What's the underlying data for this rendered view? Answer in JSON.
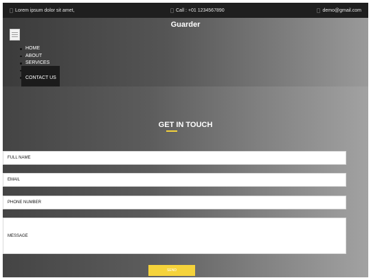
{
  "topbar": {
    "left_text": "Lorem ipsum dolor sit amet,",
    "center_text": "Call : +01 1234567890",
    "right_text": "demo@gmail.com"
  },
  "header": {
    "brand": "Guarder"
  },
  "nav": {
    "items": [
      "HOME",
      "ABOUT",
      "SERVICES",
      "CONTACT US"
    ]
  },
  "contact": {
    "title": "GET IN TOUCH",
    "fields": {
      "full_name": "FULL NAME",
      "email": "EMAIL",
      "phone": "PHONE NUMBER",
      "message": "MESSAGE"
    },
    "send_label": "SEND"
  },
  "colors": {
    "accent": "#f5d33b",
    "topbar_bg": "#1f1f1f",
    "dropdown_bg": "#1b1b1b"
  }
}
